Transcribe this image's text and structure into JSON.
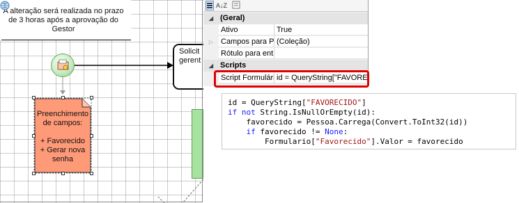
{
  "canvas": {
    "note": "A alteração será realizada no prazo de 3 horas após a aprovação do Gestor",
    "task_label": "Preenchimento de campos:\n\n+ Favorecido\n+ Gerar nova senha",
    "receive_label": "Solicit\ngerent"
  },
  "properties": {
    "toolbar": {
      "categorized_icon": "categorized-view-icon",
      "alphabetical_label": "A↓Z",
      "property_pages_icon": "property-pages-icon"
    },
    "categories": [
      {
        "label": "(Geral)",
        "rows": [
          {
            "name": "Ativo",
            "value": "True"
          },
          {
            "name": "Campos para Pr",
            "value": "(Coleção)",
            "expandable": true
          },
          {
            "name": "Rótulo para ent",
            "value": ""
          }
        ]
      },
      {
        "label": "Scripts",
        "rows": [
          {
            "name": "Script Formulári",
            "value": "id = QueryString[\"FAVOREC",
            "selected": true
          }
        ]
      }
    ],
    "highlight_color": "#e00000"
  },
  "code": {
    "lines": [
      "id = QueryString[\"FAVORECIDO\"]",
      "if not String.IsNullOrEmpty(id):",
      "    favorecido = Pessoa.Carrega(Convert.ToInt32(id))",
      "    if favorecido != None:",
      "        Formulario[\"Favorecido\"].Valor = favorecido"
    ],
    "keyword_color": "#1a1aff",
    "string_color": "#a31515"
  },
  "colors": {
    "task_fill": "#ff9a78",
    "gear_node_fill": "#c9ecc3",
    "green_lane": "#a6e2a0"
  }
}
